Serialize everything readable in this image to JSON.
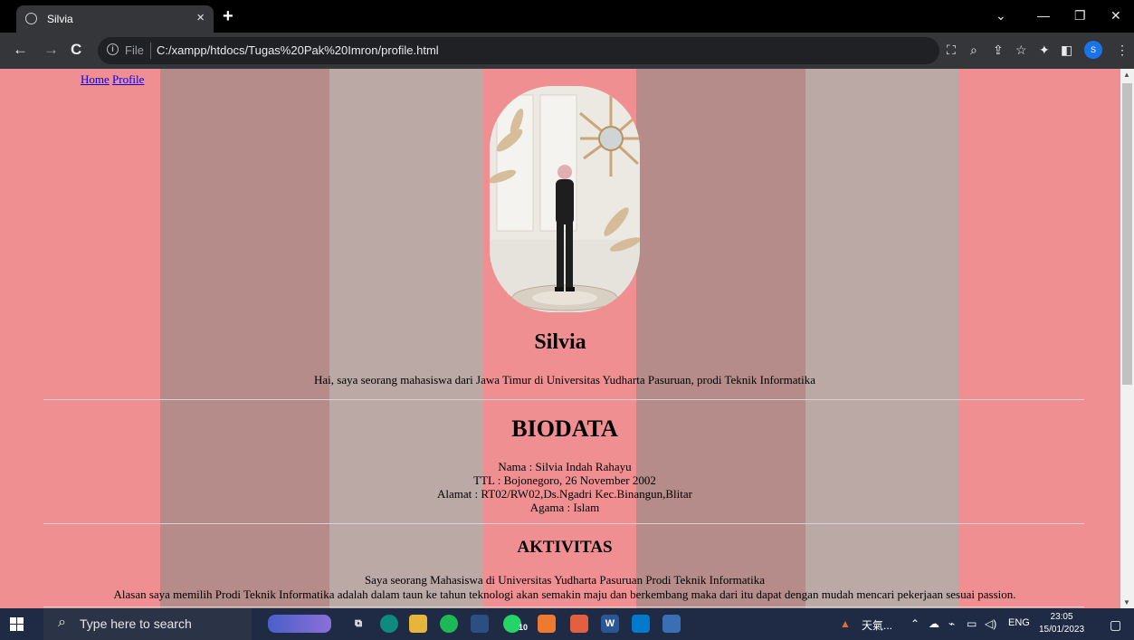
{
  "browser": {
    "tab_title": "Silvia",
    "tab_close": "×",
    "new_tab": "+",
    "file_label": "File",
    "url": "C:/xampp/htdocs/Tugas%20Pak%20Imron/profile.html",
    "profile_initial": "S"
  },
  "page": {
    "menu": [
      "Home",
      "Profile"
    ],
    "name": "Silvia",
    "intro": "Hai, saya seorang mahasiswa dari Jawa Timur di Universitas Yudharta Pasuruan, prodi Teknik Informatika",
    "biodata_heading": "BIODATA",
    "biodata": [
      "Nama : Silvia Indah Rahayu",
      "TTL : Bojonegoro, 26 November 2002",
      "Alamat : RT02/RW02,Ds.Ngadri Kec.Binangun,Blitar",
      "Agama : Islam"
    ],
    "aktivitas_heading": "AKTIVITAS",
    "aktivitas": [
      "Saya seorang Mahasiswa di Universitas Yudharta Pasuruan Prodi Teknik Informatika",
      "Alasan saya memilih Prodi Teknik Informatika adalah dalam taun ke tahun teknologi akan semakin maju dan berkembang maka dari itu dapat dengan mudah mencari pekerjaan sesuai passion."
    ],
    "colors": {
      "background": "#f08f91",
      "stripe_dark": "#b58c89",
      "stripe_light": "#bba9a6"
    }
  },
  "taskbar": {
    "search_placeholder": "Type here to search",
    "weather": "天氣...",
    "language": "ENG",
    "time": "23:05",
    "date": "15/01/2023",
    "whatsapp_badge": "10"
  }
}
